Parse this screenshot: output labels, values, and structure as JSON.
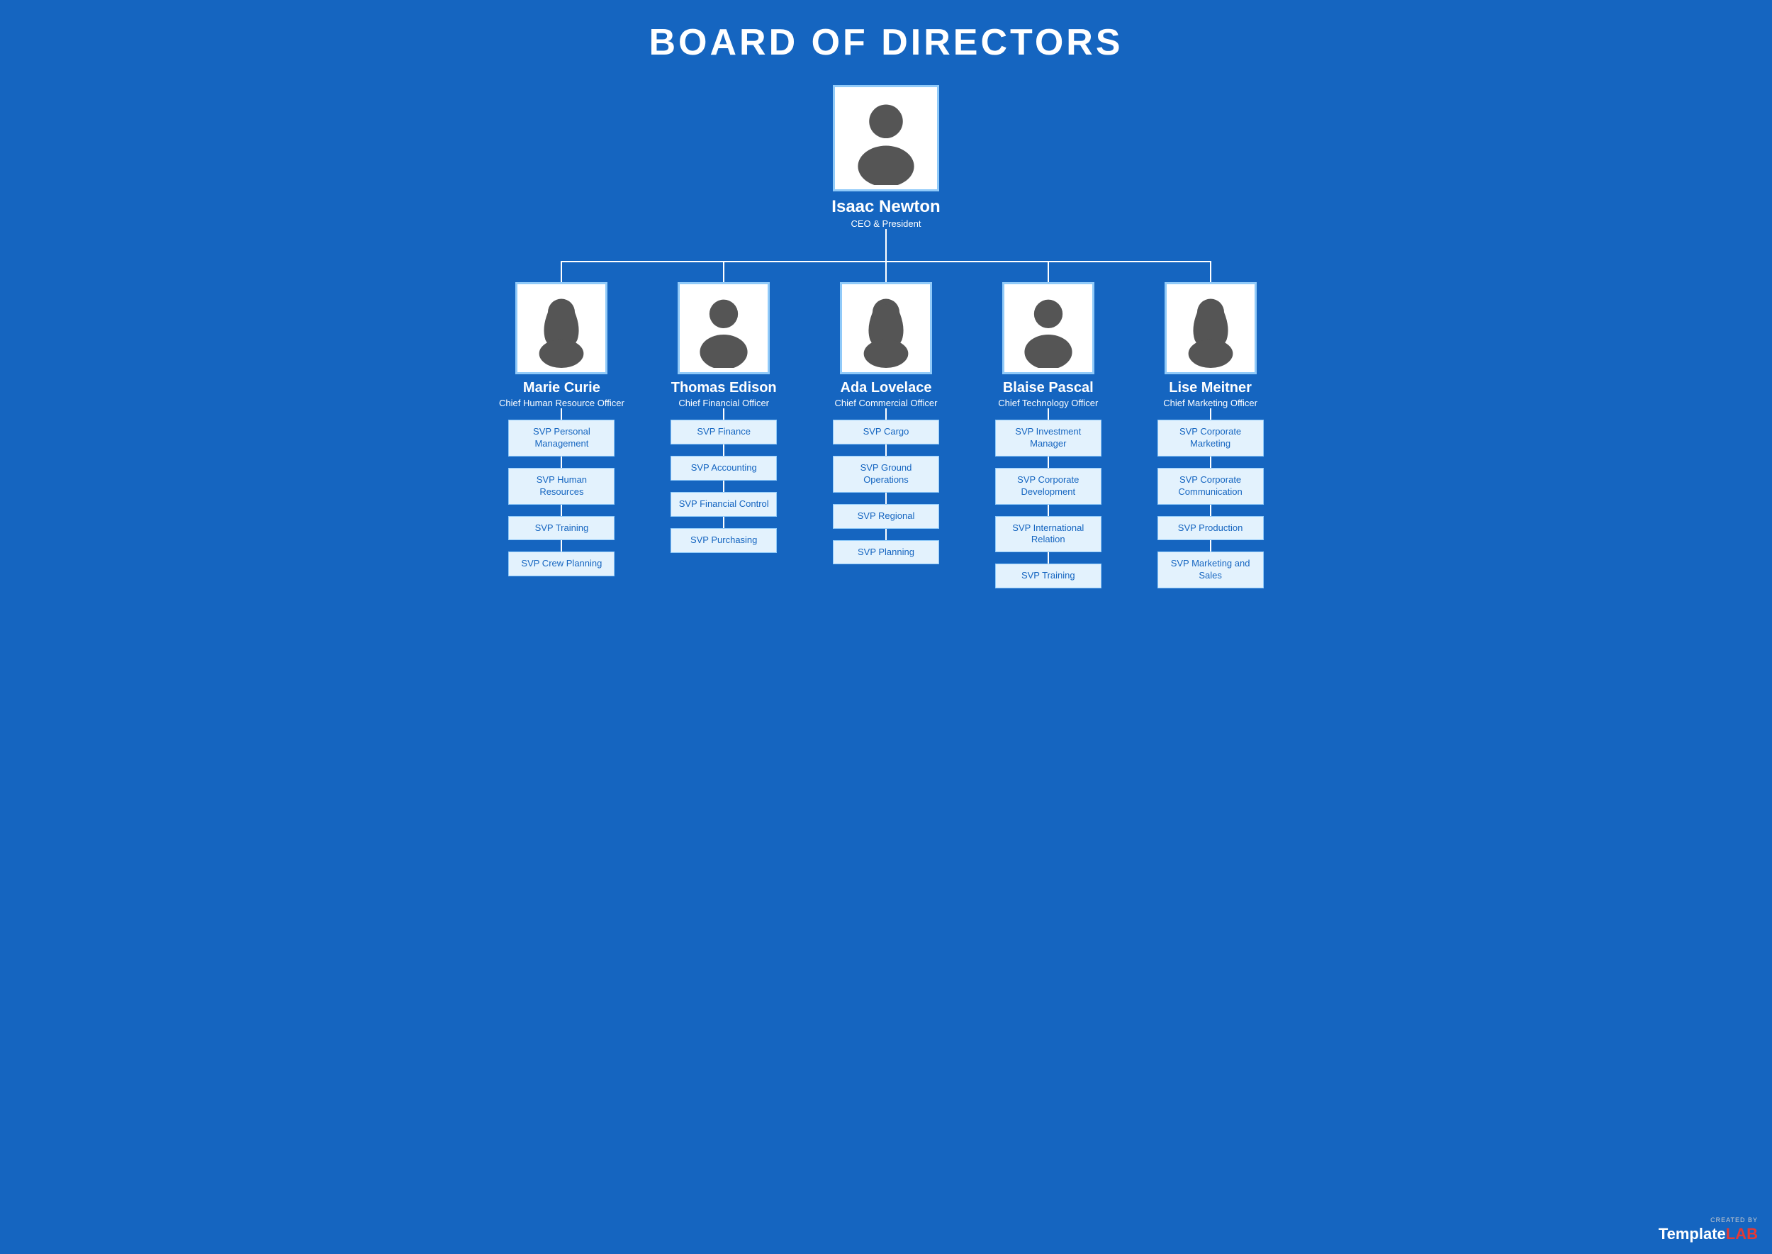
{
  "title": "BOARD OF DIRECTORS",
  "ceo": {
    "name": "Isaac Newton",
    "title": "CEO & President",
    "gender": "male"
  },
  "level2": [
    {
      "name": "Marie Curie",
      "title": "Chief Human Resource Officer",
      "gender": "female",
      "svp": [
        "SVP Personal Management",
        "SVP Human Resources",
        "SVP Training",
        "SVP Crew Planning"
      ]
    },
    {
      "name": "Thomas Edison",
      "title": "Chief Financial Officer",
      "gender": "male",
      "svp": [
        "SVP Finance",
        "SVP Accounting",
        "SVP Financial Control",
        "SVP Purchasing"
      ]
    },
    {
      "name": "Ada Lovelace",
      "title": "Chief Commercial Officer",
      "gender": "female",
      "svp": [
        "SVP Cargo",
        "SVP Ground Operations",
        "SVP Regional",
        "SVP Planning"
      ]
    },
    {
      "name": "Blaise Pascal",
      "title": "Chief Technology Officer",
      "gender": "male",
      "svp": [
        "SVP Investment Manager",
        "SVP Corporate Development",
        "SVP International Relation",
        "SVP Training"
      ]
    },
    {
      "name": "Lise Meitner",
      "title": "Chief Marketing Officer",
      "gender": "female",
      "svp": [
        "SVP Corporate Marketing",
        "SVP Corporate Communication",
        "SVP Production",
        "SVP Marketing and Sales"
      ]
    }
  ],
  "watermark": {
    "created_by": "CREATED BY",
    "template": "Template",
    "lab": "LAB"
  }
}
